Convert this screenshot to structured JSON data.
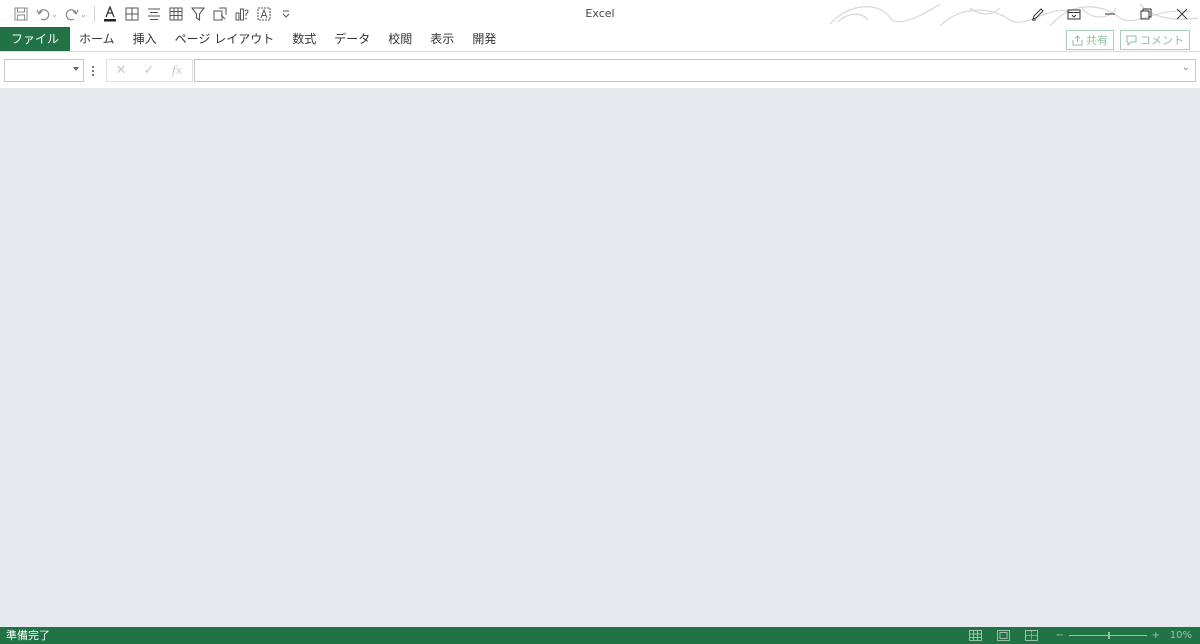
{
  "app": {
    "title": "Excel"
  },
  "qat": {
    "icons": [
      "save-icon",
      "undo-icon",
      "redo-icon",
      "font-color-icon",
      "borders-icon",
      "align-icon",
      "table-icon",
      "filter-icon",
      "select-icon",
      "chart-icon",
      "text-box-icon",
      "customize-icon"
    ]
  },
  "ribbon": {
    "tabs": [
      "ファイル",
      "ホーム",
      "挿入",
      "ページ レイアウト",
      "数式",
      "データ",
      "校閲",
      "表示",
      "開発"
    ],
    "share_label": "共有",
    "comment_label": "コメント",
    "accent_color": "#217346"
  },
  "formula_bar": {
    "name_box_value": "",
    "formula_value": "",
    "cancel_symbol": "✕",
    "enter_symbol": "✓",
    "fx_symbol": "fx"
  },
  "statusbar": {
    "text": "準備完了",
    "zoom_level": "10%",
    "zoom_minus": "−",
    "zoom_plus": "+",
    "zoom_fraction": 0.5
  }
}
